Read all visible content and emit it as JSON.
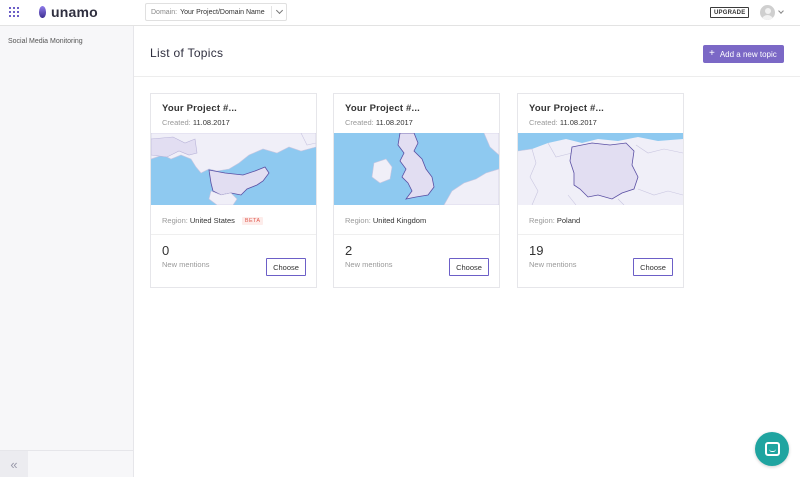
{
  "app": {
    "logo_text": "unamo"
  },
  "header": {
    "domain_label": "Domain:",
    "domain_value": "Your Project/Domain Name",
    "upgrade_label": "UPGRADE"
  },
  "sidebar": {
    "items": [
      {
        "label": "Social Media Monitoring"
      }
    ]
  },
  "main": {
    "title": "List of Topics",
    "add_button_label": "Add a new topic"
  },
  "cards": [
    {
      "title": "Your Project #...",
      "created_label": "Created:",
      "created_date": "11.08.2017",
      "region_label": "Region:",
      "region": "United States",
      "badge": "BETA",
      "count": "0",
      "mentions_label": "New mentions",
      "choose_label": "Choose",
      "map_icon": "map-united-states"
    },
    {
      "title": "Your Project #...",
      "created_label": "Created:",
      "created_date": "11.08.2017",
      "region_label": "Region:",
      "region": "United Kingdom",
      "count": "2",
      "mentions_label": "New mentions",
      "choose_label": "Choose",
      "map_icon": "map-united-kingdom"
    },
    {
      "title": "Your Project #...",
      "created_label": "Created:",
      "created_date": "11.08.2017",
      "region_label": "Region:",
      "region": "Poland",
      "count": "19",
      "mentions_label": "New mentions",
      "choose_label": "Choose",
      "map_icon": "map-poland"
    }
  ],
  "colors": {
    "accent": "#7b68c6",
    "water": "#8ec9f0",
    "land": "#f0eff8",
    "highlight_land": "#e2def2",
    "beta_text": "#e05a4f",
    "chat": "#1fa4a0"
  }
}
